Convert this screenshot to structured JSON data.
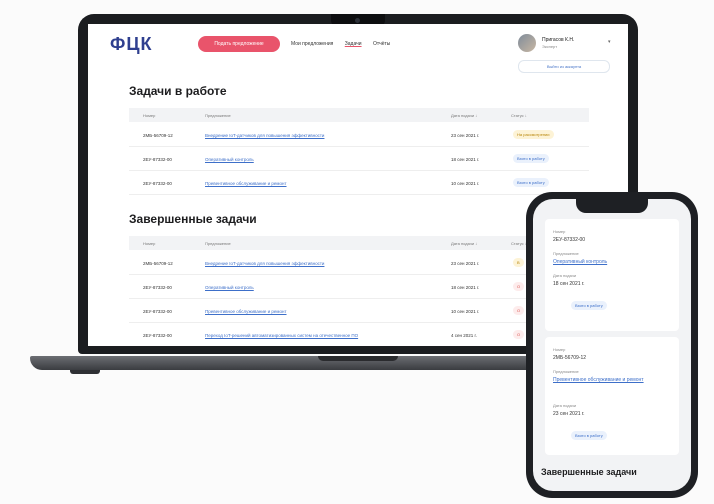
{
  "app": {
    "logo": "ФЦК",
    "cta_label": "Подать предложение",
    "nav": [
      "Мои предложения",
      "Задачи",
      "Отчёты"
    ],
    "active_nav": "Задачи",
    "user_name": "Пригасов К.Н.",
    "user_role": "Эксперт",
    "logout_label": "Выйти из аккаунта"
  },
  "columns": [
    "Номер",
    "Предложение",
    "Дата подачи ↓",
    "Статус ↓"
  ],
  "in_progress": {
    "title": "Задачи в работе",
    "rows": [
      {
        "num": "2МБ-56709-12",
        "name": "Внедрение IoT-датчиков для повышения эффективности",
        "date": "23 сен 2021 г.",
        "status": "На рассмотрении",
        "kind": "pend"
      },
      {
        "num": "2ЕУ-87332-00",
        "name": "Оперативный контроль",
        "date": "18 сен 2021 г.",
        "status": "Взято в работу",
        "kind": "work"
      },
      {
        "num": "2ЕУ-87332-00",
        "name": "Превентивное обслуживание и ремонт",
        "date": "10 сен 2021 г.",
        "status": "Взято в работу",
        "kind": "work"
      }
    ]
  },
  "completed": {
    "title": "Завершенные задачи",
    "rows": [
      {
        "num": "2МБ-56709-12",
        "name": "Внедрение IoT-датчиков для повышения эффективности",
        "date": "23 сен 2021 г.",
        "status": "В",
        "kind": "pend"
      },
      {
        "num": "2ЕУ-87332-00",
        "name": "Оперативный контроль",
        "date": "18 сен 2021 г.",
        "status": "О",
        "kind": "done"
      },
      {
        "num": "2ЕУ-87332-00",
        "name": "Превентивное обслуживание и ремонт",
        "date": "10 сен 2021 г.",
        "status": "О",
        "kind": "done"
      },
      {
        "num": "2ЕУ-87332-00",
        "name": "Переход IoT-решений автоматизированных систем на отечественное ПО",
        "date": "4 сен 2021 г.",
        "status": "О",
        "kind": "done"
      }
    ]
  },
  "phone": {
    "card1": {
      "num_label": "Номер",
      "num": "2ЕУ-87332-00",
      "name_label": "Предложение",
      "name": "Оперативный контроль",
      "date_label": "Дата подачи",
      "date": "18 сен 2021 г.",
      "status": "Взято в работу"
    },
    "card2": {
      "num_label": "Номер",
      "num": "2МБ-56709-12",
      "name_label": "Предложение",
      "name": "Превентивное обслуживание и ремонт",
      "date_label": "Дата подачи",
      "date": "23 сен 2021 г.",
      "status": "Взято в работу"
    },
    "section_title": "Завершенные задачи"
  },
  "colors": {
    "brand_blue": "#2f3f8f",
    "accent_pink": "#e9546b",
    "link": "#3d6fc9"
  }
}
